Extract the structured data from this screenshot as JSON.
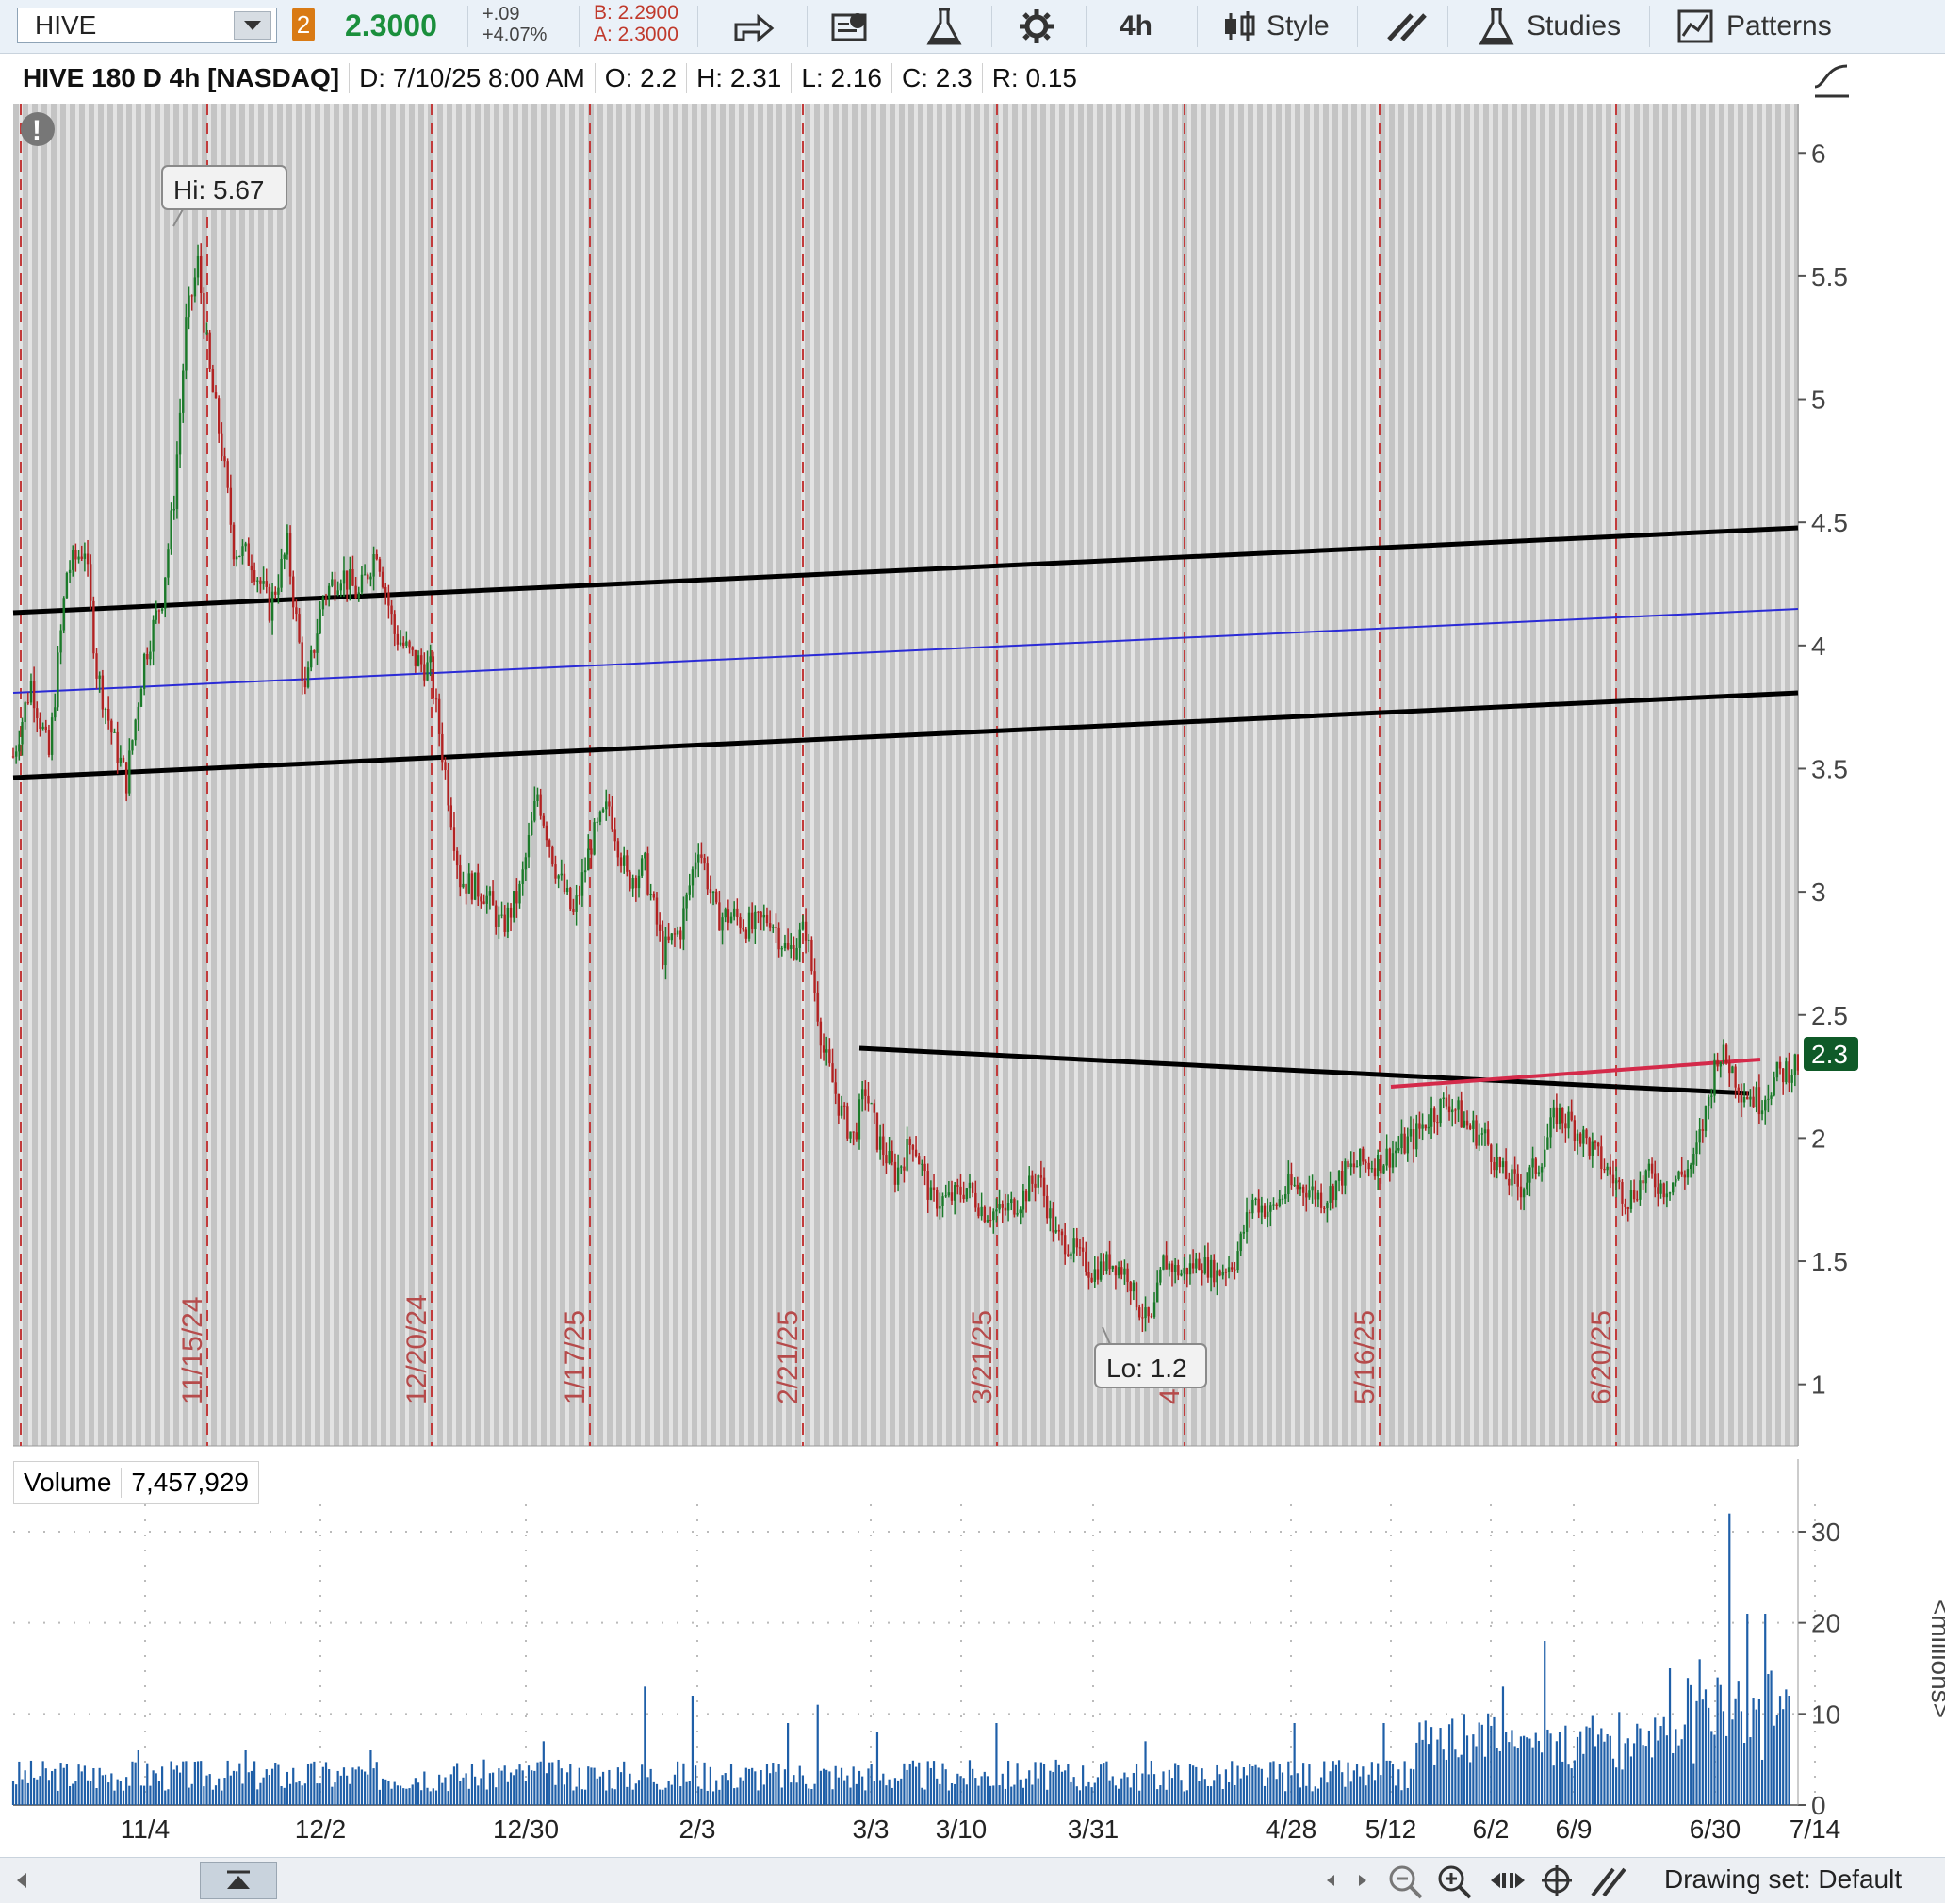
{
  "toolbar": {
    "symbol": "HIVE",
    "link_badge": "2",
    "last_price": "2.3000",
    "net_change": "+.09",
    "net_change_pct": "+4.07%",
    "bid": "B: 2.2900",
    "ask": "A: 2.3000",
    "interval": "4h",
    "style_label": "Style",
    "studies_label": "Studies",
    "patterns_label": "Patterns"
  },
  "header": {
    "title": "HIVE 180 D 4h [NASDAQ]",
    "date": "D: 7/10/25 8:00 AM",
    "open": "O: 2.2",
    "high": "H: 2.31",
    "low": "L: 2.16",
    "close": "C: 2.3",
    "range": "R: 0.15"
  },
  "volume_header": {
    "label": "Volume",
    "value": "7,457,929"
  },
  "footer": {
    "drawing_set": "Drawing set: Default"
  },
  "colors": {
    "up_candle": "#1b7a2a",
    "down_candle": "#b22222",
    "volume_bar": "#1f5fa8",
    "shade": "#c4c4c4",
    "trend_black": "#000000",
    "trend_blue": "#2a2ad6",
    "trend_red": "#d42a4a",
    "price_badge": "#0f5a28"
  },
  "chart_data": [
    {
      "type": "candlestick",
      "symbol": "HIVE",
      "timeframe": "180 D 4h",
      "y_ticks": [
        "1",
        "1.5",
        "2",
        "2.5",
        "3",
        "3.5",
        "4",
        "4.5",
        "5",
        "5.5",
        "6"
      ],
      "ylim": [
        0.75,
        6.2
      ],
      "session_markers": [
        "11/15/24",
        "12/20/24",
        "1/17/25",
        "2/21/25",
        "3/21/25",
        "4/25",
        "5/16/25",
        "6/20/25"
      ],
      "annotations": {
        "high_label": "Hi: 5.67",
        "low_label": "Lo: 1.2",
        "price_badge": "2.3"
      },
      "path": [
        [
          0,
          3.55
        ],
        [
          6,
          3.85
        ],
        [
          12,
          3.55
        ],
        [
          18,
          4.3
        ],
        [
          24,
          4.4
        ],
        [
          28,
          3.9
        ],
        [
          34,
          3.6
        ],
        [
          38,
          3.45
        ],
        [
          44,
          3.95
        ],
        [
          50,
          4.2
        ],
        [
          54,
          4.6
        ],
        [
          58,
          5.3
        ],
        [
          62,
          5.55
        ],
        [
          66,
          5.1
        ],
        [
          70,
          4.8
        ],
        [
          74,
          4.4
        ],
        [
          80,
          4.35
        ],
        [
          86,
          4.15
        ],
        [
          92,
          4.4
        ],
        [
          98,
          3.8
        ],
        [
          104,
          4.2
        ],
        [
          110,
          4.3
        ],
        [
          116,
          4.2
        ],
        [
          122,
          4.4
        ],
        [
          128,
          4.05
        ],
        [
          134,
          3.95
        ],
        [
          140,
          3.9
        ],
        [
          146,
          3.4
        ],
        [
          150,
          3.05
        ],
        [
          158,
          3.0
        ],
        [
          164,
          2.85
        ],
        [
          170,
          3.0
        ],
        [
          176,
          3.4
        ],
        [
          182,
          3.1
        ],
        [
          188,
          2.9
        ],
        [
          194,
          3.2
        ],
        [
          200,
          3.35
        ],
        [
          206,
          3.05
        ],
        [
          212,
          3.1
        ],
        [
          218,
          2.75
        ],
        [
          224,
          2.85
        ],
        [
          230,
          3.2
        ],
        [
          236,
          2.9
        ],
        [
          242,
          2.9
        ],
        [
          248,
          2.85
        ],
        [
          254,
          2.9
        ],
        [
          260,
          2.75
        ],
        [
          266,
          2.85
        ],
        [
          272,
          2.35
        ],
        [
          278,
          2.1
        ],
        [
          282,
          2.0
        ],
        [
          286,
          2.2
        ],
        [
          290,
          2.0
        ],
        [
          296,
          1.85
        ],
        [
          302,
          2.0
        ],
        [
          308,
          1.75
        ],
        [
          314,
          1.75
        ],
        [
          320,
          1.8
        ],
        [
          326,
          1.7
        ],
        [
          332,
          1.7
        ],
        [
          338,
          1.75
        ],
        [
          344,
          1.85
        ],
        [
          350,
          1.6
        ],
        [
          356,
          1.55
        ],
        [
          362,
          1.45
        ],
        [
          368,
          1.5
        ],
        [
          374,
          1.45
        ],
        [
          378,
          1.3
        ],
        [
          382,
          1.25
        ],
        [
          386,
          1.5
        ],
        [
          392,
          1.45
        ],
        [
          398,
          1.5
        ],
        [
          404,
          1.45
        ],
        [
          410,
          1.5
        ],
        [
          416,
          1.75
        ],
        [
          422,
          1.7
        ],
        [
          428,
          1.8
        ],
        [
          434,
          1.8
        ],
        [
          440,
          1.75
        ],
        [
          446,
          1.85
        ],
        [
          452,
          1.9
        ],
        [
          458,
          1.9
        ],
        [
          464,
          1.95
        ],
        [
          470,
          2.0
        ],
        [
          476,
          2.1
        ],
        [
          482,
          2.15
        ],
        [
          488,
          2.05
        ],
        [
          494,
          2.0
        ],
        [
          500,
          1.85
        ],
        [
          506,
          1.8
        ],
        [
          512,
          1.9
        ],
        [
          518,
          2.1
        ],
        [
          524,
          2.05
        ],
        [
          530,
          1.95
        ],
        [
          536,
          1.85
        ],
        [
          542,
          1.75
        ],
        [
          548,
          1.85
        ],
        [
          554,
          1.8
        ],
        [
          560,
          1.85
        ],
        [
          564,
          1.9
        ],
        [
          568,
          2.1
        ],
        [
          572,
          2.35
        ],
        [
          576,
          2.3
        ],
        [
          580,
          2.2
        ],
        [
          586,
          2.15
        ],
        [
          592,
          2.25
        ],
        [
          598,
          2.3
        ]
      ]
    },
    {
      "type": "bar",
      "name": "Volume",
      "y_unit": "<millions>",
      "y_ticks": [
        "0",
        "10",
        "20",
        "30"
      ],
      "ylim": [
        0,
        33
      ],
      "x_ticks": [
        "11/4",
        "12/2",
        "12/30",
        "2/3",
        "3/3",
        "3/10",
        "3/31",
        "4/28",
        "5/12",
        "6/2",
        "6/9",
        "6/30",
        "7/14"
      ],
      "spikes": [
        [
          42,
          6
        ],
        [
          78,
          6
        ],
        [
          120,
          6
        ],
        [
          178,
          7
        ],
        [
          212,
          13
        ],
        [
          228,
          12
        ],
        [
          260,
          9
        ],
        [
          270,
          11
        ],
        [
          290,
          8
        ],
        [
          330,
          9
        ],
        [
          380,
          7
        ],
        [
          430,
          9
        ],
        [
          460,
          9
        ],
        [
          500,
          13
        ],
        [
          514,
          18
        ],
        [
          556,
          15
        ],
        [
          566,
          16
        ],
        [
          576,
          32
        ],
        [
          582,
          21
        ],
        [
          588,
          21
        ],
        [
          596,
          12
        ]
      ]
    }
  ]
}
